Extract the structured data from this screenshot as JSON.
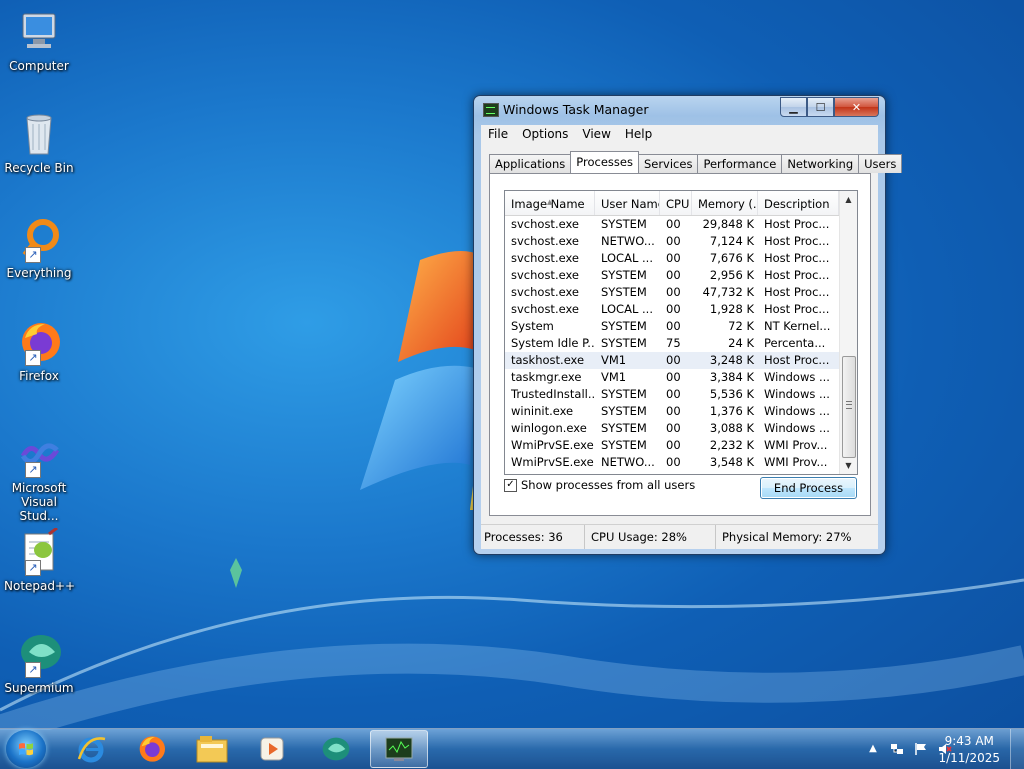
{
  "desktop": {
    "icons": [
      {
        "label": "Computer"
      },
      {
        "label": "Recycle Bin"
      },
      {
        "label": "Everything"
      },
      {
        "label": "Firefox"
      },
      {
        "label": "Microsoft Visual Stud..."
      },
      {
        "label": "Notepad++"
      },
      {
        "label": "Supermium"
      }
    ]
  },
  "window": {
    "title": "Windows Task Manager",
    "menu": [
      "File",
      "Options",
      "View",
      "Help"
    ],
    "tabs": [
      "Applications",
      "Processes",
      "Services",
      "Performance",
      "Networking",
      "Users"
    ],
    "active_tab": "Processes",
    "columns": [
      "Image Name",
      "User Name",
      "CPU",
      "Memory (...",
      "Description"
    ],
    "rows": [
      [
        "svchost.exe",
        "SYSTEM",
        "00",
        "29,848 K",
        "Host Proc..."
      ],
      [
        "svchost.exe",
        "NETWO...",
        "00",
        "7,124 K",
        "Host Proc..."
      ],
      [
        "svchost.exe",
        "LOCAL ...",
        "00",
        "7,676 K",
        "Host Proc..."
      ],
      [
        "svchost.exe",
        "SYSTEM",
        "00",
        "2,956 K",
        "Host Proc..."
      ],
      [
        "svchost.exe",
        "SYSTEM",
        "00",
        "47,732 K",
        "Host Proc..."
      ],
      [
        "svchost.exe",
        "LOCAL ...",
        "00",
        "1,928 K",
        "Host Proc..."
      ],
      [
        "System",
        "SYSTEM",
        "00",
        "72 K",
        "NT Kernel..."
      ],
      [
        "System Idle P...",
        "SYSTEM",
        "75",
        "24 K",
        "Percenta..."
      ],
      [
        "taskhost.exe",
        "VM1",
        "00",
        "3,248 K",
        "Host Proc..."
      ],
      [
        "taskmgr.exe",
        "VM1",
        "00",
        "3,384 K",
        "Windows ..."
      ],
      [
        "TrustedInstall...",
        "SYSTEM",
        "00",
        "5,536 K",
        "Windows ..."
      ],
      [
        "wininit.exe",
        "SYSTEM",
        "00",
        "1,376 K",
        "Windows ..."
      ],
      [
        "winlogon.exe",
        "SYSTEM",
        "00",
        "3,088 K",
        "Windows ..."
      ],
      [
        "WmiPrvSE.exe",
        "SYSTEM",
        "00",
        "2,232 K",
        "WMI Prov..."
      ],
      [
        "WmiPrvSE.exe",
        "NETWO...",
        "00",
        "3,548 K",
        "WMI Prov..."
      ]
    ],
    "selected_row": 8,
    "show_all_label": "Show processes from all users",
    "show_all_checked": true,
    "end_process_label": "End Process",
    "status": {
      "processes": "Processes: 36",
      "cpu": "CPU Usage: 28%",
      "memory": "Physical Memory: 27%"
    }
  },
  "taskbar": {
    "apps": [
      "Internet Explorer",
      "Firefox",
      "Windows Explorer",
      "Media Player",
      "Supermium",
      "Task Manager"
    ],
    "active_app": "Task Manager",
    "clock_time": "9:43 AM",
    "clock_date": "1/11/2025"
  }
}
